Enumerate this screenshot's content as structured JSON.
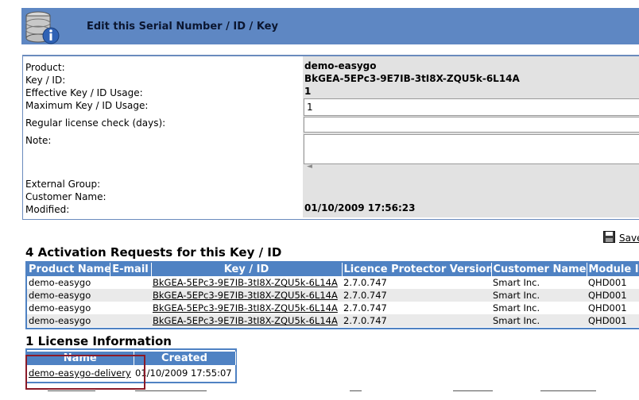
{
  "header": {
    "title": "Edit this Serial Number / ID / Key",
    "icon": "database-info-icon"
  },
  "form": {
    "labels": {
      "product": "Product:",
      "key": "Key / ID:",
      "effective_usage": "Effective Key / ID Usage:",
      "max_usage": "Maximum Key / ID Usage:",
      "license_check": "Regular license check (days):",
      "note": "Note:",
      "external_group": "External Group:",
      "customer_name": "Customer Name:",
      "modified": "Modified:"
    },
    "values": {
      "product": "demo-easygo",
      "key": "BkGEA-5EPc3-9E7IB-3tI8X-ZQU5k-6L14A",
      "effective_usage": "1",
      "max_usage": "1",
      "license_check": "",
      "note": "",
      "external_group": "",
      "customer_name": "",
      "modified": "01/10/2009 17:56:23"
    }
  },
  "save": {
    "label": "Save"
  },
  "activations": {
    "title": "4 Activation Requests for this Key / ID",
    "columns": [
      "Product Name",
      "E-mail",
      "Key / ID",
      "Licence Protector Version",
      "Customer Name",
      "Module I"
    ],
    "rows": [
      [
        "demo-easygo",
        "",
        "BkGEA-5EPc3-9E7IB-3tI8X-ZQU5k-6L14A",
        "2.7.0.747",
        "Smart Inc.",
        "QHD001"
      ],
      [
        "demo-easygo",
        "",
        "BkGEA-5EPc3-9E7IB-3tI8X-ZQU5k-6L14A",
        "2.7.0.747",
        "Smart Inc.",
        "QHD001"
      ],
      [
        "demo-easygo",
        "",
        "BkGEA-5EPc3-9E7IB-3tI8X-ZQU5k-6L14A",
        "2.7.0.747",
        "Smart Inc.",
        "QHD001"
      ],
      [
        "demo-easygo",
        "",
        "BkGEA-5EPc3-9E7IB-3tI8X-ZQU5k-6L14A",
        "2.7.0.747",
        "Smart Inc.",
        "QHD001"
      ]
    ]
  },
  "license_info": {
    "title": "1 License Information",
    "columns": [
      "Name",
      "Created"
    ],
    "rows": [
      [
        "demo-easygo-delivery",
        "01/10/2009 17:55:07"
      ]
    ]
  },
  "colors": {
    "header_bg": "#5e87c3",
    "table_header": "#4f82c3",
    "highlight_border": "#8a1a28",
    "value_column_bg": "#e2e2e2"
  }
}
